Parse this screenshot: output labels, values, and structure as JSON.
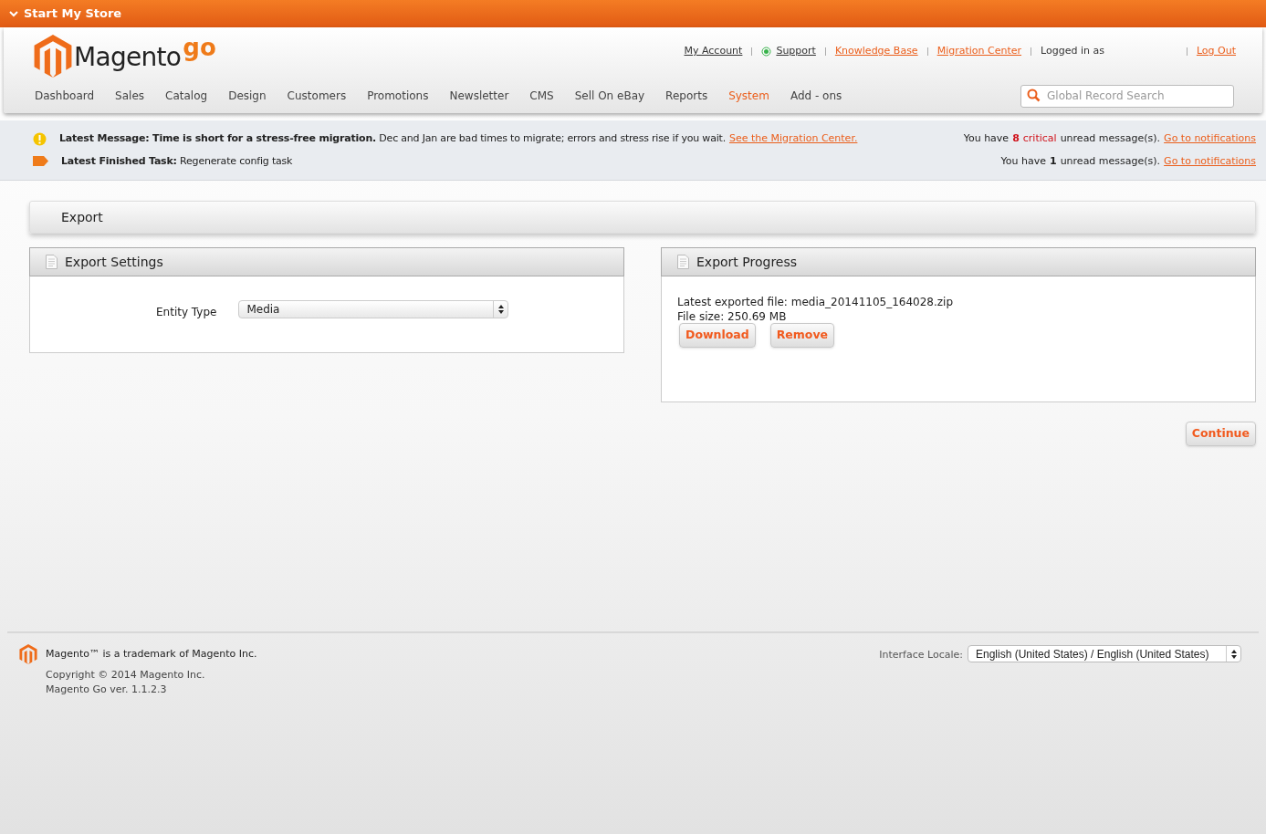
{
  "store_bar": {
    "label": "Start My Store"
  },
  "logo": {
    "name": "Magento",
    "suffix": "go"
  },
  "top_links": [
    {
      "label": "My Account",
      "kind": "plain"
    },
    {
      "label": "Support",
      "kind": "status"
    },
    {
      "label": "Knowledge Base",
      "kind": "accent"
    },
    {
      "label": "Migration Center",
      "kind": "accent"
    },
    {
      "label": "Logged in as",
      "kind": "text"
    },
    {
      "label": "Log Out",
      "kind": "accent"
    }
  ],
  "nav": [
    {
      "label": "Dashboard",
      "selected": false
    },
    {
      "label": "Sales",
      "selected": false
    },
    {
      "label": "Catalog",
      "selected": false
    },
    {
      "label": "Design",
      "selected": false
    },
    {
      "label": "Customers",
      "selected": false
    },
    {
      "label": "Promotions",
      "selected": false
    },
    {
      "label": "Newsletter",
      "selected": false
    },
    {
      "label": "CMS",
      "selected": false
    },
    {
      "label": "Sell On eBay",
      "selected": false
    },
    {
      "label": "Reports",
      "selected": false
    },
    {
      "label": "System",
      "selected": true
    },
    {
      "label": "Add - ons",
      "selected": false
    }
  ],
  "search": {
    "placeholder": "Global Record Search"
  },
  "messages": [
    {
      "kind": "warning",
      "text": "**Latest Message: Time is short for a stress-free migration.** Dec and Jan are bad times to migrate; errors and stress rise if you wait.",
      "link": "See the Migration Center.",
      "summary": {
        "prefix": "You have",
        "count": "8",
        "severity": "critical",
        "suffix": "unread message(s).",
        "link": "Go to notifications"
      }
    },
    {
      "kind": "task",
      "text": "**Latest Finished Task:** Regenerate config task",
      "summary": {
        "prefix": "You have",
        "count": "1",
        "suffix": "unread message(s).",
        "link": "Go to notifications"
      }
    }
  ],
  "page_title": "Export",
  "settings": {
    "title": "Export Settings",
    "field_label": "Entity Type",
    "value": "Media"
  },
  "progress": {
    "title": "Export Progress",
    "lines": [
      "Latest exported file: media_20141105_164028.zip",
      "File size: 250.69 MB"
    ],
    "buttons": [
      "Download",
      "Remove"
    ]
  },
  "continue_button": "Continue",
  "footer": {
    "trademark": "Magento™ is a trademark of Magento Inc.",
    "lines": [
      "Copyright © 2014 Magento Inc.",
      "Magento Go ver. 1.1.2.3"
    ],
    "locale_label": "Interface Locale:",
    "locale_value": "English (United States) / English (United States)"
  }
}
